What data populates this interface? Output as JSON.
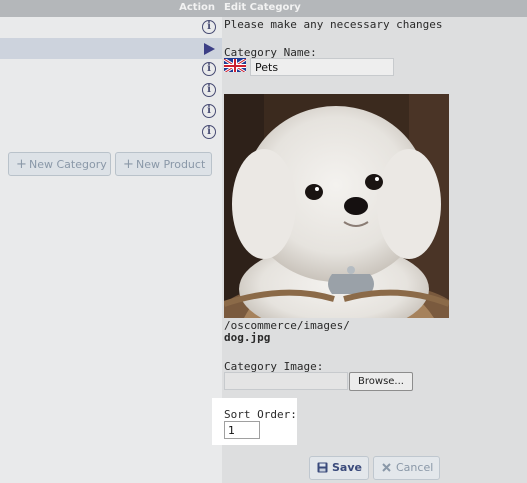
{
  "left": {
    "header": {
      "action_label": "Action"
    },
    "rows": [
      {
        "icon": "info-icon",
        "selected": false
      },
      {
        "icon": "arrow-right-icon",
        "selected": true
      },
      {
        "icon": "info-icon",
        "selected": false
      },
      {
        "icon": "info-icon",
        "selected": false
      },
      {
        "icon": "info-icon",
        "selected": false
      },
      {
        "icon": "info-icon",
        "selected": false
      }
    ],
    "buttons": {
      "new_category": "New Category",
      "new_product": "New Product"
    }
  },
  "edit": {
    "title": "Edit Category",
    "intro": "Please make any necessary changes",
    "name_label": "Category Name:",
    "name_value": "Pets",
    "image_path": "/oscommerce/images/",
    "image_file": "dog.jpg",
    "image_label": "Category Image:",
    "browse_label": "Browse...",
    "sort_label": "Sort Order:",
    "sort_value": "1",
    "save_label": "Save",
    "cancel_label": "Cancel"
  },
  "colors": {
    "header": "#b4b7ba",
    "selected_row": "#cdd3dd",
    "icon": "#474b73",
    "button_text": "#8a98a8",
    "highlight": "#ffffff"
  }
}
